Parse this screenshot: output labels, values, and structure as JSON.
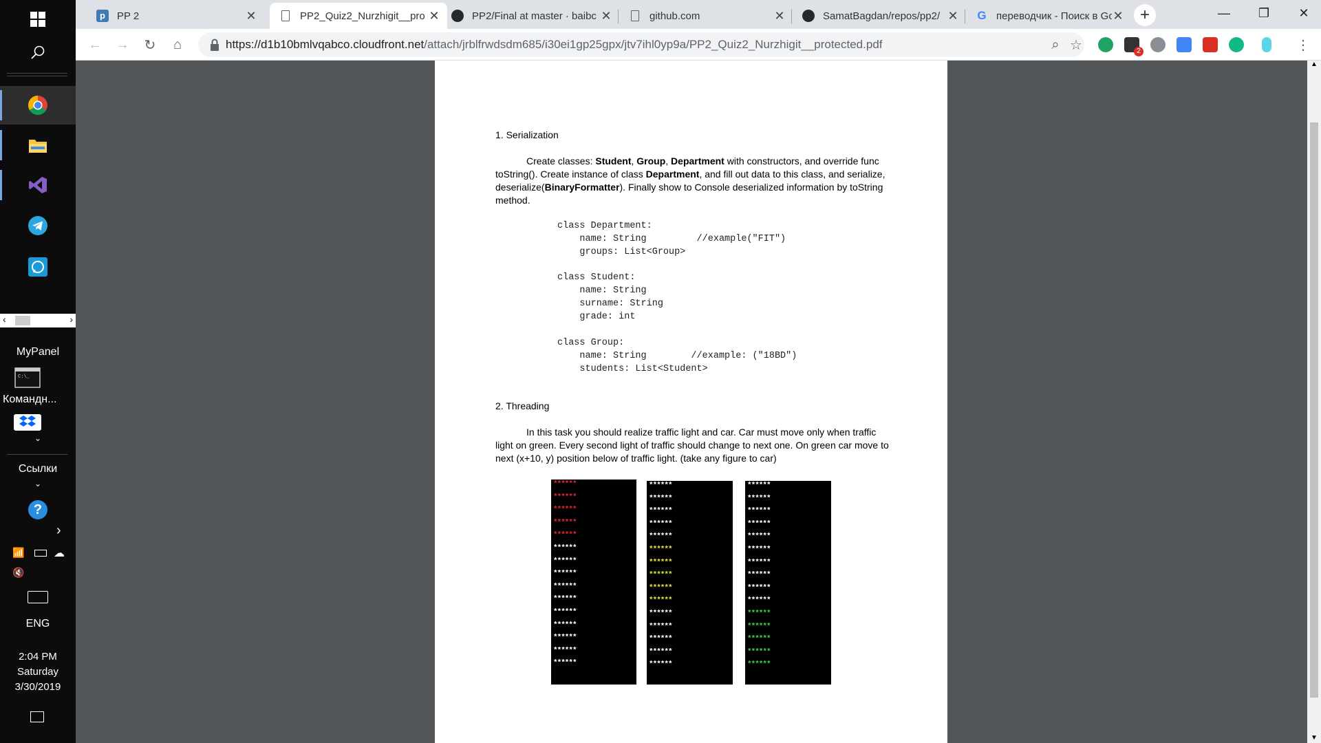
{
  "taskbar": {
    "mypanel_label": "MyPanel",
    "cmd_label": "Командн...",
    "links_label": "Ссылки",
    "lang": "ENG",
    "time": "2:04 PM",
    "day": "Saturday",
    "date": "3/30/2019"
  },
  "tabs": [
    {
      "title": "PP 2",
      "icon": "piazza-icon"
    },
    {
      "title": "PP2_Quiz2_Nurzhigit__pro",
      "icon": "page-icon"
    },
    {
      "title": "PP2/Final at master · baibc",
      "icon": "github-icon"
    },
    {
      "title": "github.com",
      "icon": "page-icon"
    },
    {
      "title": "SamatBagdan/repos/pp2/",
      "icon": "github-icon"
    },
    {
      "title": "переводчик - Поиск в Go",
      "icon": "google-icon"
    }
  ],
  "toolbar": {
    "url_host": "https://d1b10bmlvqabco.cloudfront.net",
    "url_path": "/attach/jrblfrwdsdm685/i30ei1gp25gpx/jtv7ihl0yp9a/PP2_Quiz2_Nurzhigit__protected.pdf",
    "ext_badge": "2"
  },
  "document": {
    "s1_heading": "1. Serialization",
    "s1_p_1": "Create classes: ",
    "s1_b_student": "Student",
    "s1_comma1": ", ",
    "s1_b_group": "Group",
    "s1_comma2": ", ",
    "s1_b_department": "Department",
    "s1_p_2": " with constructors, and override func",
    "s1_line2_a": "toString(). Create instance of class ",
    "s1_line2_b": "Department",
    "s1_line2_c": ", and fill out data to this class, and serialize,",
    "s1_line3_a": "deserialize(",
    "s1_line3_b": "BinaryFormatter",
    "s1_line3_c": "). Finally show to Console deserialized information by toString",
    "s1_line4": "method.",
    "code_department": "class Department:\n    name: String         //example(\"FIT\")\n    groups: List<Group>",
    "code_student": "class Student:\n    name: String\n    surname: String\n    grade: int",
    "code_group": "class Group:\n    name: String        //example: (\"18BD\")\n    students: List<Student>",
    "s2_heading": "2. Threading",
    "s2_line1": "In this task you should realize traffic light and car. Car must move only when traffic",
    "s2_line2": "light on green. Every second light of traffic should change to next one. On green car move to",
    "s2_line3": "next  (x+10, y) position below of traffic light. (take any figure to car)",
    "light_row": "******",
    "colors": {
      "red": "#e8262a",
      "yellow": "#e5e23a",
      "green": "#3bd04a",
      "white": "#ffffff"
    }
  }
}
